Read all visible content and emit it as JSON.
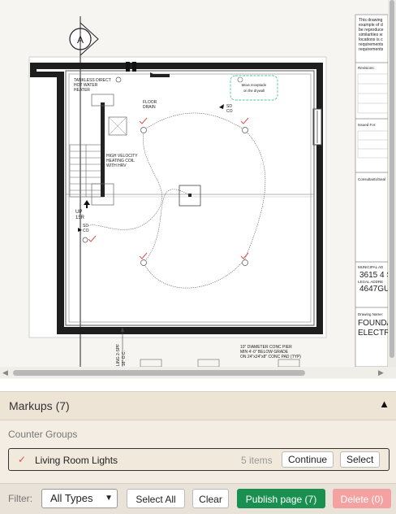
{
  "drawing": {
    "grid_bubble": "A",
    "water_heater_note": [
      "TANKLESS DIRECT",
      "HOT WATER",
      "HEATER"
    ],
    "floor_drain_note": [
      "FLOOR",
      "DRAIN"
    ],
    "co_note": [
      "SD",
      "CO"
    ],
    "heating_note": [
      "HIGH VELOCITY",
      "HEATING COIL",
      "WITH HRV"
    ],
    "stair_label": "UP",
    "stair_count": "15R",
    "sd_co_left": [
      "SD",
      "CO"
    ],
    "revision_cloud_note": [
      "Move receptacle",
      "on the drywall"
    ],
    "footing_note": [
      "10\" DIAMETER CONC PIER",
      "MIN 4'-0\" BELOW GRADE",
      "ON 24\"x24\"x8\" CONC PAD (TYP)"
    ],
    "joist_note": [
      "LING 2-SPF",
      "16\" O.C."
    ]
  },
  "title_block": {
    "notes_lines": [
      "This drawing",
      "example of d",
      "be reproduce",
      "similarities w",
      "locations is c",
      "requirements",
      "requirements"
    ],
    "revisions_label": "Revisions:",
    "issued_label": "Issued For:",
    "consultants_label": "Consultants/Seal",
    "municipal_label": "MUNICIPAL AD",
    "municipal_value": "3615 4 S",
    "legal_label": "LEGAL ADDRE",
    "legal_value": "4647GU",
    "drawing_name_label": "Drawing Name:",
    "drawing_name_lines": [
      "FOUNDA",
      "ELECTR"
    ]
  },
  "panel": {
    "title": "Markups (7)",
    "toggle_icon": "▲",
    "counter_groups_label": "Counter Groups",
    "group": {
      "check_icon": "✓",
      "name": "Living Room Lights",
      "count": "5 items",
      "continue_label": "Continue",
      "select_label": "Select"
    }
  },
  "filter_bar": {
    "filter_label": "Filter:",
    "type_value": "All Types",
    "select_all_label": "Select All",
    "clear_label": "Clear",
    "publish_label": "Publish page (7)",
    "delete_label": "Delete (0)"
  },
  "colors": {
    "accent_green": "#1a9050",
    "delete_disabled": "#f4a1a1",
    "markup_red": "#d9534f",
    "cloud_green": "#4fc4a0"
  }
}
